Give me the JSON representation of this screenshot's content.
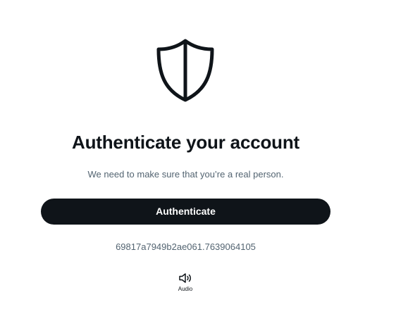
{
  "main": {
    "icon": "shield-icon",
    "title": "Authenticate your account",
    "subtitle": "We need to make sure that you’re a real person.",
    "authenticate_label": "Authenticate",
    "session_id": "69817a7949b2ae061.7639064105",
    "audio": {
      "icon": "speaker-icon",
      "label": "Audio"
    }
  },
  "colors": {
    "text_primary": "#0f1419",
    "text_secondary": "#536471",
    "button_bg": "#0f1419",
    "button_text": "#ffffff",
    "background": "#ffffff"
  }
}
